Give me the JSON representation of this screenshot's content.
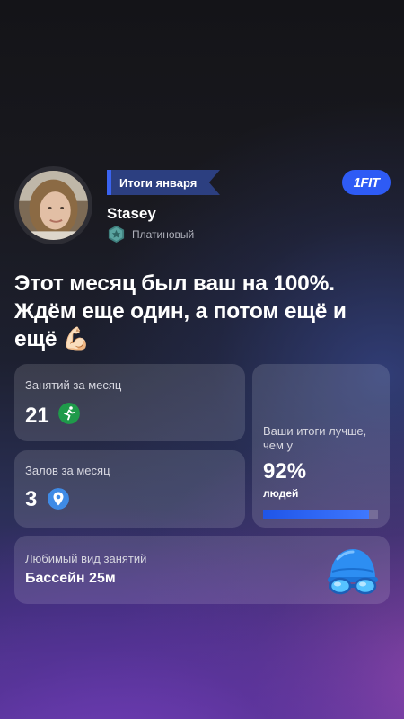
{
  "header": {
    "month_tag": "Итоги января",
    "logo": "1FIT",
    "username": "Stasey",
    "tier": "Платиновый",
    "accent_color": "#2e5bf5"
  },
  "headline": "Этот месяц был ваш на 100%. Ждём еще один, а потом ещё и ещё 💪🏻",
  "stats": {
    "sessions": {
      "label": "Занятий за месяц",
      "value": "21",
      "icon": "running-person-icon"
    },
    "gyms": {
      "label": "Залов за месяц",
      "value": "3",
      "icon": "map-pin-icon"
    },
    "comparison": {
      "text": "Ваши итоги лучше, чем у",
      "value": "92%",
      "suffix": "людей",
      "progress": 0.92
    },
    "favorite": {
      "label": "Любимый вид занятий",
      "value": "Бассейн 25м",
      "icon": "swim-cap-goggles-icon"
    }
  }
}
